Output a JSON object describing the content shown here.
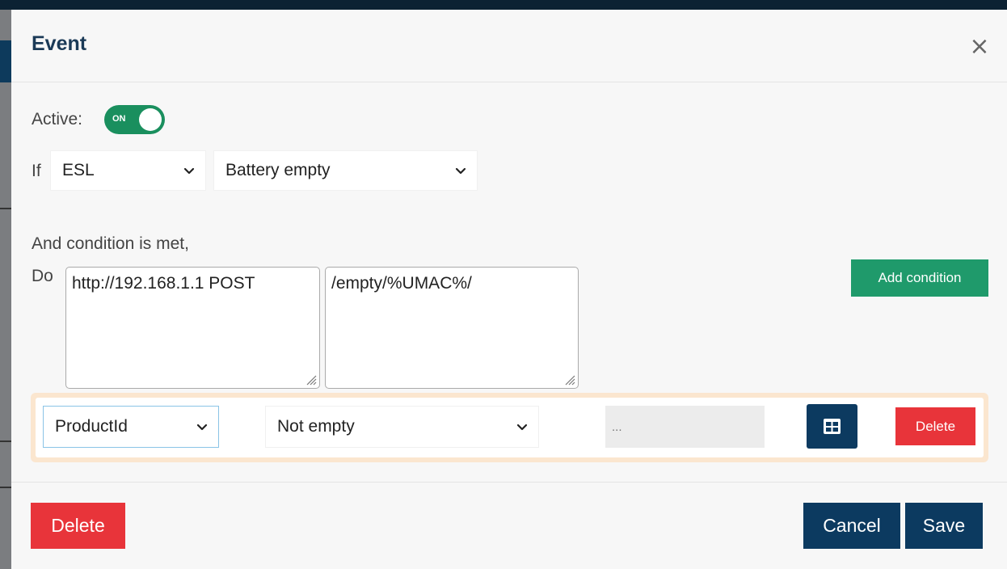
{
  "modal": {
    "title": "Event",
    "close_symbol": "×"
  },
  "active": {
    "label": "Active:",
    "toggle_text": "ON",
    "state": true
  },
  "trigger": {
    "label": "If",
    "source_value": "ESL",
    "event_value": "Battery empty"
  },
  "action": {
    "condition_label": "And condition is met,",
    "do_label": "Do",
    "url_text": "http://192.168.1.1 POST",
    "path_text": "/empty/%UMAC%/",
    "add_condition_label": "Add condition"
  },
  "condition": {
    "field_value": "ProductId",
    "operator_value": "Not empty",
    "value_placeholder": "...",
    "delete_label": "Delete"
  },
  "footer": {
    "delete_label": "Delete",
    "cancel_label": "Cancel",
    "save_label": "Save"
  },
  "colors": {
    "title": "#1b3a57",
    "toggle_on": "#1a8f5e",
    "add_condition": "#1f9a6b",
    "danger": "#e8343a",
    "primary": "#0c3a60",
    "condition_border": "#fbe6cf"
  },
  "icons": [
    "close-icon",
    "chevron-down-icon",
    "resize-handle-icon",
    "table-icon"
  ]
}
